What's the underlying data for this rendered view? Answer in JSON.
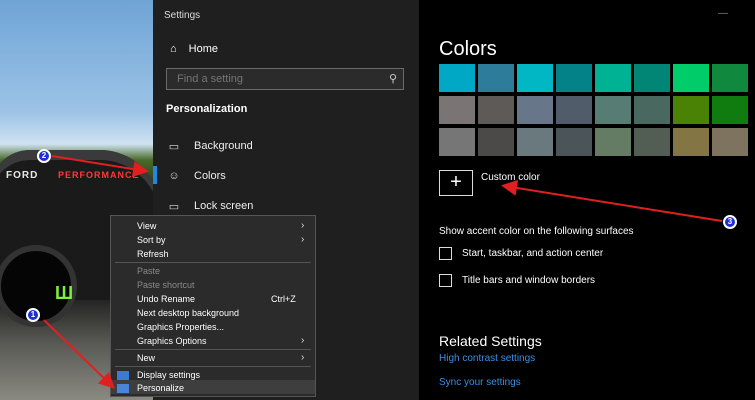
{
  "desktop": {
    "ford_text": "FORD",
    "performance_text": "PERFORMANCE"
  },
  "settings": {
    "title": "Settings",
    "home": "Home",
    "search_placeholder": "Find a setting",
    "section": "Personalization",
    "nav": [
      "Background",
      "Colors",
      "Lock screen"
    ],
    "accent_bar_color": "#1e88e5"
  },
  "colors_page": {
    "title": "Colors",
    "swatch_rows": [
      [
        "#00a8c6",
        "#2d7d9a",
        "#00b7c3",
        "#038387",
        "#00b294",
        "#018574",
        "#00cc6a",
        "#10893e"
      ],
      [
        "#7a7574",
        "#5d5a58",
        "#68768a",
        "#515c6b",
        "#567c73",
        "#486860",
        "#498205",
        "#107c10"
      ],
      [
        "#767676",
        "#4c4a48",
        "#69797e",
        "#4a5459",
        "#647c64",
        "#525e54",
        "#847545",
        "#7e735f"
      ]
    ],
    "custom_color": "Custom color",
    "accent_heading": "Show accent color on the following surfaces",
    "checkboxes": [
      "Start, taskbar, and action center",
      "Title bars and window borders"
    ],
    "related_title": "Related Settings",
    "links": [
      "High contrast settings",
      "Sync your settings"
    ]
  },
  "context_menu": {
    "items": [
      "View",
      "Sort by",
      "Refresh",
      "Paste",
      "Paste shortcut",
      "Undo Rename",
      "Next desktop background",
      "Graphics Properties...",
      "Graphics Options",
      "New",
      "Display settings",
      "Personalize"
    ],
    "undo_shortcut": "Ctrl+Z"
  },
  "annotations": {
    "badges": [
      "1",
      "2",
      "3"
    ],
    "arrow_color": "#e02020"
  }
}
